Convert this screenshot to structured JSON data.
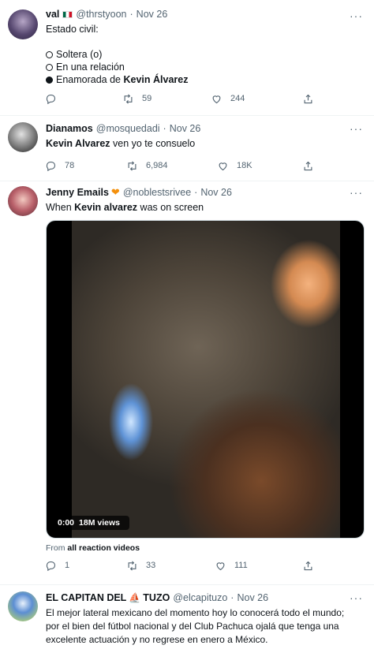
{
  "tweets": [
    {
      "name": "val",
      "handle": "@thrstyoon",
      "date": "Nov 26",
      "text_intro": "Estado civil:",
      "poll": [
        {
          "text": "Soltera (o)",
          "bold": ""
        },
        {
          "text": "En una relación",
          "bold": ""
        },
        {
          "text": "Enamorada de ",
          "bold": "Kevin Álvarez"
        }
      ],
      "replies": "",
      "retweets": "59",
      "likes": "244"
    },
    {
      "name": "Dianamos",
      "handle": "@mosquedadi",
      "date": "Nov 26",
      "text_bold": "Kevin Alvarez",
      "text_rest": " ven yo te consuelo",
      "replies": "78",
      "retweets": "6,984",
      "likes": "18K"
    },
    {
      "name": "Jenny Emails",
      "handle": "@noblestsrivee",
      "date": "Nov 26",
      "text_pre": "When ",
      "text_bold": "Kevin alvarez",
      "text_post": " was on screen",
      "video_time": "0:00",
      "video_views": "18M views",
      "from_prefix": "From ",
      "from_link": "all reaction videos",
      "replies": "1",
      "retweets": "33",
      "likes": "111"
    },
    {
      "name_a": "EL CAPITAN DEL",
      "name_b": "TUZO",
      "handle": "@elcapituzo",
      "date": "Nov 26",
      "text": "El mejor lateral mexicano del momento hoy lo conocerá todo el mundo; por el bien del fútbol nacional y del Club Pachuca ojalá que tenga una excelente actuación y no regrese en enero a México."
    }
  ],
  "separator_dot": "·",
  "more_glyph": "···",
  "icons": [
    "reply-icon",
    "retweet-icon",
    "like-icon",
    "share-icon",
    "more-icon",
    "mexico-flag-icon",
    "orange-heart-icon",
    "ship-icon"
  ]
}
